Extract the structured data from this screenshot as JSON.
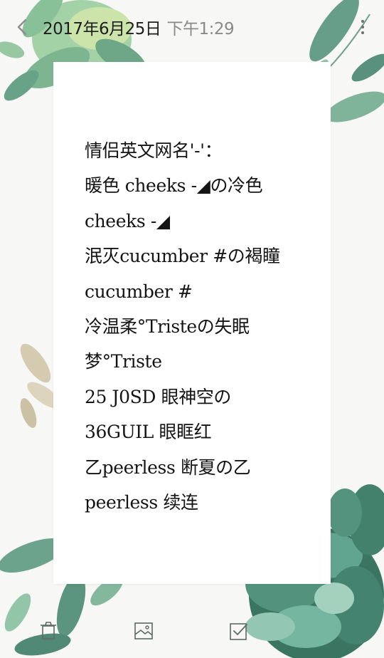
{
  "header": {
    "date": "2017年6月25日",
    "time": "下午1:29",
    "back_icon": "chevron-left-icon",
    "more_icon": "more-vertical-icon"
  },
  "note": {
    "text": "情侣英文网名'-'：\n暖色 cheeks -◢の冷色\ncheeks -◢\n泯灭cucumber #の褐瞳\ncucumber #\n冷温柔°Tristeの失眠\n梦°Triste\n25 J0SD 眼神空の\n36GUIL 眼眶红\n乙peerless 断夏の乙\npeerless 续连"
  },
  "toolbar": {
    "icons": [
      "trash-icon",
      "image-icon",
      "checkbox-icon"
    ]
  },
  "colors": {
    "background": "#f7f7f5",
    "card": "#ffffff",
    "text": "#141414",
    "time_text": "#8a8a8a",
    "leaf_dark": "#2f6f5a",
    "leaf_light": "#8fc39a",
    "leaf_tan": "#cfc4a6"
  }
}
